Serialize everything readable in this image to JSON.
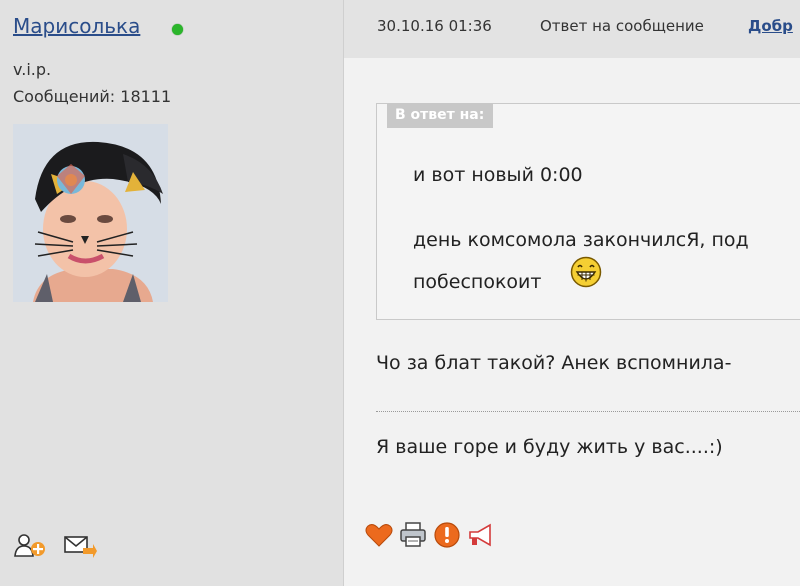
{
  "author": {
    "username": "Марисолька",
    "online_status_color": "#2bb52b",
    "rank": "v.i.p.",
    "post_count_label": "Сообщений: 18111"
  },
  "post_header": {
    "timestamp": "30.10.16 01:36",
    "reply_label": "Ответ на сообщение",
    "reply_link": "Добр"
  },
  "quote": {
    "label": "В ответ на:",
    "line1": "и вот новый 0:00",
    "line2": "день комсомола закончилсЯ, под",
    "line3": "побеспокоит"
  },
  "message": {
    "line1": "Чо за блат такой? Анек вспомнила-",
    "line2": "Я ваше горе и буду жить у вас....:)"
  },
  "icons": {
    "sidebar_actions": [
      "add-friend-icon",
      "send-message-icon"
    ],
    "post_actions": [
      "heart-icon",
      "print-icon",
      "report-icon",
      "megaphone-icon"
    ],
    "smiley": "grin-smiley-icon"
  },
  "colors": {
    "link": "#2a4d8a",
    "sidebar_bg": "#e1e1e1",
    "content_bg": "#f2f2f2"
  }
}
